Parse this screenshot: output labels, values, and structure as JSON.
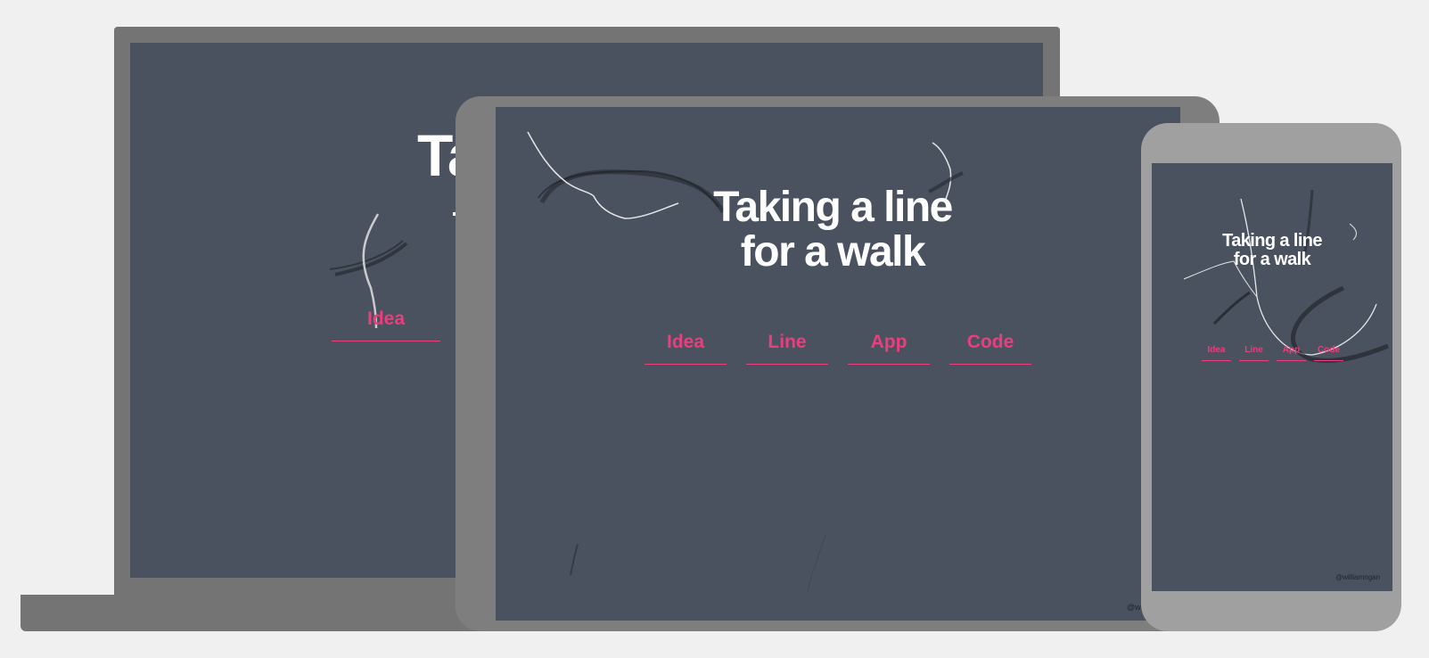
{
  "site": {
    "title_line1": "Taking a line",
    "title_line2": "for a walk",
    "laptop_title_fragment": "Ta",
    "nav": [
      "Idea",
      "Line",
      "App",
      "Code"
    ],
    "credit": "@williamngan",
    "credit_tablet_fragment": "@wil"
  },
  "colors": {
    "page_background": "#f0f0f0",
    "screen_background": "#4a5260",
    "accent_pink": "#ec3d7c",
    "title_white": "#ffffff",
    "laptop_frame": "#747474",
    "tablet_frame": "#7e7e7e",
    "phone_frame": "#a0a0a0"
  }
}
